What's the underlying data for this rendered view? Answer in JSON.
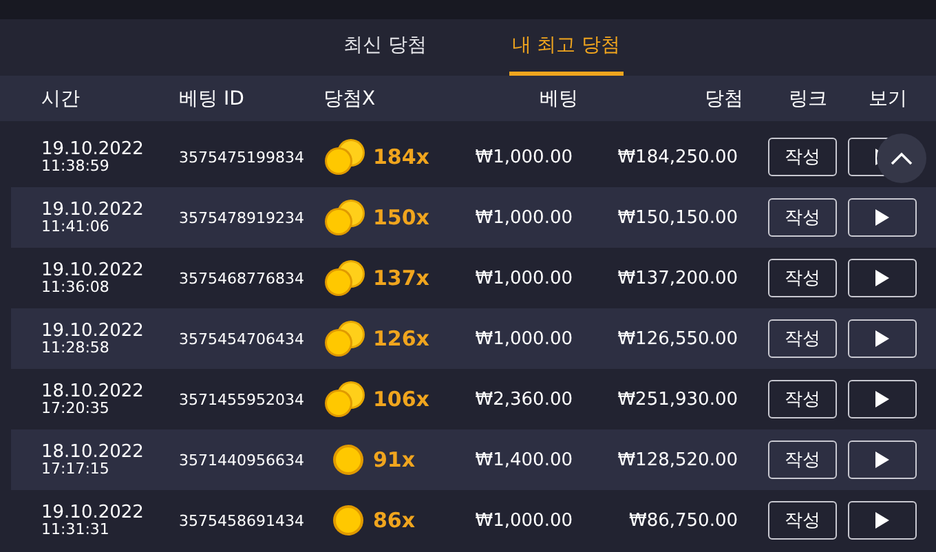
{
  "tabs": [
    {
      "label": "최신 당첨",
      "selected": false
    },
    {
      "label": "내 최고 당첨",
      "selected": true
    }
  ],
  "table": {
    "columns": [
      "시간",
      "베팅 ID",
      "당첨X",
      "베팅",
      "당첨",
      "링크",
      "보기"
    ],
    "rows": [
      {
        "date": "19.10.2022",
        "time": "11:38:59",
        "bet_id": "3575475199834",
        "kind": "stack",
        "multiplier": "184x",
        "bet": "₩1,000.00",
        "win": "₩184,250.00",
        "link": "작성"
      },
      {
        "date": "19.10.2022",
        "time": "11:41:06",
        "bet_id": "3575478919234",
        "kind": "stack",
        "multiplier": "150x",
        "bet": "₩1,000.00",
        "win": "₩150,150.00",
        "link": "작성"
      },
      {
        "date": "19.10.2022",
        "time": "11:36:08",
        "bet_id": "3575468776834",
        "kind": "stack",
        "multiplier": "137x",
        "bet": "₩1,000.00",
        "win": "₩137,200.00",
        "link": "작성"
      },
      {
        "date": "19.10.2022",
        "time": "11:28:58",
        "bet_id": "3575454706434",
        "kind": "stack",
        "multiplier": "126x",
        "bet": "₩1,000.00",
        "win": "₩126,550.00",
        "link": "작성"
      },
      {
        "date": "18.10.2022",
        "time": "17:20:35",
        "bet_id": "3571455952034",
        "kind": "stack",
        "multiplier": "106x",
        "bet": "₩2,360.00",
        "win": "₩251,930.00",
        "link": "작성"
      },
      {
        "date": "18.10.2022",
        "time": "17:17:15",
        "bet_id": "3571440956634",
        "kind": "single",
        "multiplier": "91x",
        "bet": "₩1,400.00",
        "win": "₩128,520.00",
        "link": "작성"
      },
      {
        "date": "19.10.2022",
        "time": "11:31:31",
        "bet_id": "3575458691434",
        "kind": "single",
        "multiplier": "86x",
        "bet": "₩1,000.00",
        "win": "₩86,750.00",
        "link": "작성"
      }
    ]
  }
}
